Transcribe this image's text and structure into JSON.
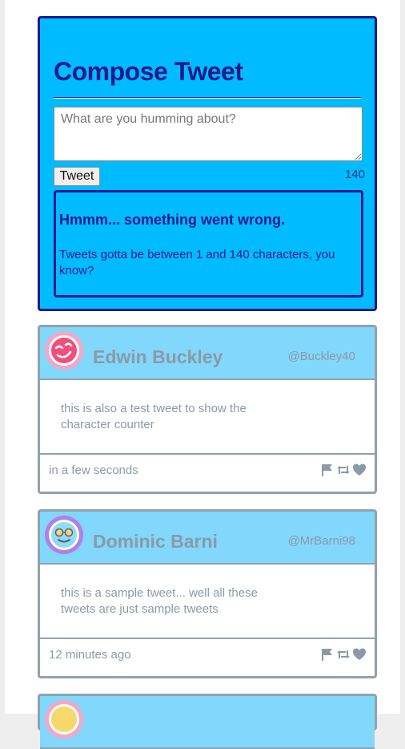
{
  "colors": {
    "compose_bg": "#00bbff",
    "compose_border": "#1a1a8c",
    "tweet_header_bg": "#82d7fc",
    "tweet_border": "#8fa3ad",
    "muted_text": "#8a9aa6"
  },
  "compose": {
    "title": "Compose Tweet",
    "placeholder": "What are you humming about?",
    "tweet_button_label": "Tweet",
    "char_counter": "140",
    "error": {
      "title": "Hmmm... something went wrong.",
      "message": "Tweets gotta be between 1 and 140 characters, you know?"
    }
  },
  "tweets": [
    {
      "name": "Edwin Buckley",
      "handle": "@Buckley40",
      "text": "this is also a test tweet to show the character counter",
      "time": "in a few seconds",
      "avatar_icon": "pink-face-avatar-icon"
    },
    {
      "name": "Dominic Barni",
      "handle": "@MrBarni98",
      "text": "this is a sample tweet... well all these tweets are just sample tweets",
      "time": "12 minutes ago",
      "avatar_icon": "glasses-face-avatar-icon"
    }
  ],
  "action_icons": [
    "flag-icon",
    "retweet-icon",
    "heart-icon"
  ]
}
